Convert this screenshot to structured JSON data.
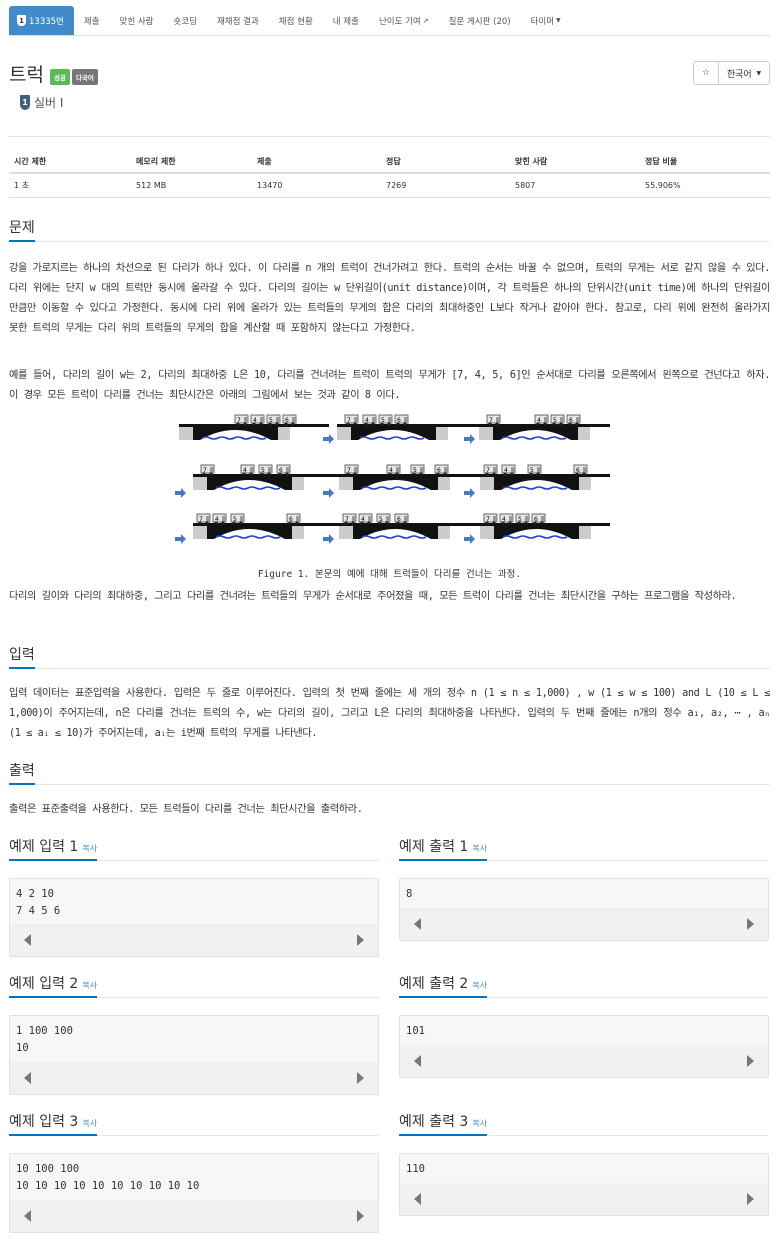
{
  "nav": {
    "items": [
      {
        "label": "13335번",
        "active": true
      },
      {
        "label": "제출"
      },
      {
        "label": "맞힌 사람"
      },
      {
        "label": "숏코딩"
      },
      {
        "label": "재채점 결과"
      },
      {
        "label": "채점 현황"
      },
      {
        "label": "내 제출"
      },
      {
        "label": "난이도 기여"
      },
      {
        "label": "질문 게시판 (20)"
      },
      {
        "label": "타이머"
      }
    ],
    "badge": "1"
  },
  "problem": {
    "title": "트럭",
    "labels": [
      "성공",
      "다국어"
    ],
    "tier": "실버 I",
    "tier_badge": "1",
    "star_icon": "☆",
    "language": "한국어"
  },
  "info": {
    "headers": [
      "시간 제한",
      "메모리 제한",
      "제출",
      "정답",
      "맞힌 사람",
      "정답 비율"
    ],
    "values": [
      "1 초",
      "512 MB",
      "13470",
      "7269",
      "5807",
      "55.906%"
    ]
  },
  "sections": {
    "problem": "문제",
    "input": "입력",
    "output": "출력"
  },
  "text": {
    "p1": "강을 가로지르는 하나의 차선으로 된 다리가 하나 있다. 이 다리를 n 개의 트럭이 건너가려고 한다. 트럭의 순서는 바꿀 수 없으며, 트럭의 무게는 서로 같지 않을 수 있다. 다리 위에는 단지 w 대의 트럭만 동시에 올라갈 수 있다. 다리의 길이는 w 단위길이(unit distance)이며, 각 트럭들은 하나의 단위시간(unit time)에 하나의 단위길이만큼만 이동할 수 있다고 가정한다. 동시에 다리 위에 올라가 있는 트럭들의 무게의 합은 다리의 최대하중인 L보다 작거나 같아야 한다. 참고로, 다리 위에 완전히 올라가지 못한 트럭의 무게는 다리 위의 트럭들의 무게의 합을 계산할 때 포함하지 않는다고 가정한다.",
    "p2": "예를 들어, 다리의 길이 w는 2, 다리의 최대하중 L은 10, 다리를 건너려는 트럭이 트럭의 무게가 [7, 4, 5, 6]인 순서대로 다리를 오른쪽에서 왼쪽으로 건넌다고 하자. 이 경우 모든 트럭이 다리를 건너는 최단시간은 아래의 그림에서 보는 것과 같이 8 이다.",
    "caption": "Figure 1. 본문의 예에 대해 트럭들이 다리를 건너는 과정.",
    "p3": "다리의 길이와 다리의 최대하중, 그리고 다리를 건너려는 트럭들의 무게가 순서대로 주어졌을 때, 모든 트럭이 다리를 건너는 최단시간을 구하는 프로그램을 작성하라.",
    "input": "입력 데이터는 표준입력을 사용한다. 입력은 두 줄로 이루어진다. 입력의 첫 번째 줄에는 세 개의 정수 n (1 ≤ n ≤ 1,000) , w (1 ≤ w ≤ 100) and L (10 ≤ L ≤ 1,000)이 주어지는데, n은 다리를 건너는 트럭의 수, w는 다리의 길이, 그리고 L은 다리의 최대하중을 나타낸다. 입력의 두 번째 줄에는 n개의 정수 a₁, a₂, ⋯ , aₙ (1 ≤ aᵢ ≤ 10)가 주어지는데, aᵢ는 i번째 트럭의 무게를 나타낸다.",
    "output": "출력은 표준출력을 사용한다. 모든 트럭들이 다리를 건너는 최단시간을 출력하라."
  },
  "figure": {
    "truck_weights": [
      "7",
      "4",
      "5",
      "6"
    ]
  },
  "samples": {
    "copy_label": "복사",
    "items": [
      {
        "in_title": "예제 입력 1",
        "in": "4 2 10\n7 4 5 6",
        "out_title": "예제 출력 1",
        "out": "8"
      },
      {
        "in_title": "예제 입력 2",
        "in": "1 100 100\n10",
        "out_title": "예제 출력 2",
        "out": "101"
      },
      {
        "in_title": "예제 입력 3",
        "in": "10 100 100\n10 10 10 10 10 10 10 10 10 10",
        "out_title": "예제 출력 3",
        "out": "110"
      }
    ]
  },
  "colors": {
    "nav_active": "#428bca",
    "label_success": "#5cb85c",
    "label_multilang": "#777777",
    "section_underline": "#0076c0",
    "link": "#428bca"
  }
}
